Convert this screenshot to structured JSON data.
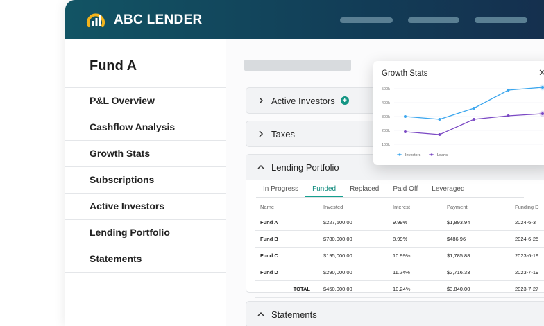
{
  "header": {
    "brand": "ABC LENDER",
    "accent": "#f2b31b",
    "icons": [
      "logo-icon"
    ]
  },
  "sidebar": {
    "title": "Fund A",
    "items": [
      {
        "label": "P&L Overview"
      },
      {
        "label": "Cashflow Analysis"
      },
      {
        "label": "Growth Stats"
      },
      {
        "label": "Subscriptions"
      },
      {
        "label": "Active Investors"
      },
      {
        "label": "Lending Portfolio"
      },
      {
        "label": "Statements"
      }
    ]
  },
  "panels": {
    "active_investors": "Active Investors",
    "taxes": "Taxes",
    "lending_portfolio": "Lending Portfolio",
    "statements": "Statements"
  },
  "portfolio": {
    "tabs": [
      "In Progress",
      "Funded",
      "Replaced",
      "Paid Off",
      "Leveraged"
    ],
    "active_tab": "Funded",
    "columns": [
      "Name",
      "Invested",
      "Interest",
      "Payment",
      "Funding D"
    ],
    "rows": [
      [
        "Fund A",
        "$227,500.00",
        "9.99%",
        "$1,893.94",
        "2024-6-3"
      ],
      [
        "Fund B",
        "$780,000.00",
        "8.99%",
        "$486.96",
        "2024-6-25"
      ],
      [
        "Fund C",
        "$195,000.00",
        "10.99%",
        "$1,785.88",
        "2023-6-19"
      ],
      [
        "Fund D",
        "$290,000.00",
        "11.24%",
        "$2,716.33",
        "2023-7-19"
      ]
    ],
    "total": [
      "TOTAL",
      "$450,000.00",
      "10.24%",
      "$3,840.00",
      "2023-7-27"
    ]
  },
  "growth_popup": {
    "title": "Growth Stats",
    "close_icon": "close-icon",
    "colors": {
      "investors": "#3aa6ee",
      "loans": "#7b49c4"
    }
  },
  "chart_data": {
    "type": "line",
    "title": "Growth Stats",
    "y_ticks": [
      "500k",
      "400k",
      "300k",
      "200k",
      "100k"
    ],
    "ylim": [
      100,
      500
    ],
    "x": [
      1,
      2,
      3,
      4,
      5
    ],
    "series": [
      {
        "name": "Investors",
        "values": [
          300,
          280,
          360,
          490,
          510
        ]
      },
      {
        "name": "Loans",
        "values": [
          190,
          170,
          280,
          305,
          320
        ]
      }
    ],
    "legend": "bottom-left",
    "grid": true
  }
}
